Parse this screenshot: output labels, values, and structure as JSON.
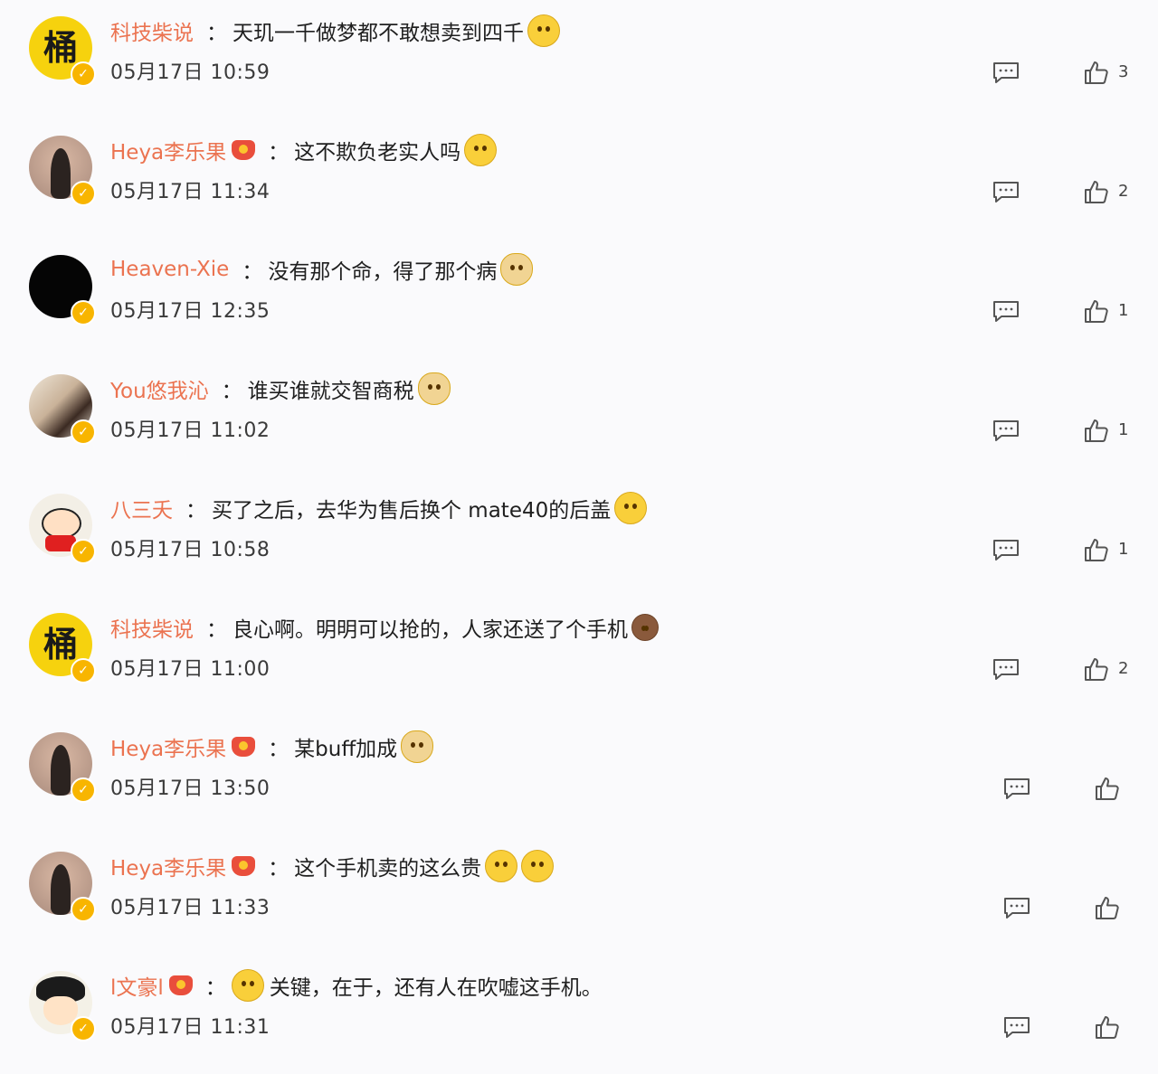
{
  "comments": [
    {
      "user": "科技柴说",
      "avatar": "bucket",
      "avatar_text": "桶",
      "medal": false,
      "sep": "：",
      "text": "天玑一千做梦都不敢想卖到四千",
      "emojis": [
        "grin-emoji"
      ],
      "time": "05月17日 10:59",
      "likes": "3",
      "layout": "wide"
    },
    {
      "user": "Heya李乐果",
      "avatar": "silhouette",
      "medal": true,
      "sep": "：",
      "text": "这不欺负老实人吗",
      "emojis": [
        "cry-laugh-emoji"
      ],
      "time": "05月17日 11:34",
      "likes": "2",
      "layout": "wide"
    },
    {
      "user": "Heaven-Xie",
      "avatar": "black",
      "medal": false,
      "sep": "：",
      "text": "没有那个命，得了那个病",
      "emojis": [
        "doge-emoji"
      ],
      "time": "05月17日 12:35",
      "likes": "1",
      "layout": "wide"
    },
    {
      "user": "You悠我沁",
      "avatar": "photo",
      "medal": false,
      "sep": "：",
      "text": "谁买谁就交智商税",
      "emojis": [
        "doge-emoji"
      ],
      "time": "05月17日 11:02",
      "likes": "1",
      "layout": "wide"
    },
    {
      "user": "八三夭",
      "avatar": "cartoon",
      "medal": false,
      "sep": "：",
      "text": "买了之后，去华为售后换个 mate40的后盖",
      "emojis": [
        "dizzy-emoji"
      ],
      "time": "05月17日 10:58",
      "likes": "1",
      "layout": "wide"
    },
    {
      "user": "科技柴说",
      "avatar": "bucket",
      "avatar_text": "桶",
      "medal": false,
      "sep": "：",
      "text": "良心啊。明明可以抢的，人家还送了个手机",
      "emojis": [
        "monkey-emoji"
      ],
      "time": "05月17日 11:00",
      "likes": "2",
      "layout": "wide"
    },
    {
      "user": "Heya李乐果",
      "avatar": "silhouette",
      "medal": true,
      "sep": "：",
      "text": "某buff加成",
      "emojis": [
        "doge-emoji"
      ],
      "time": "05月17日 13:50",
      "likes": "",
      "layout": "narrow"
    },
    {
      "user": "Heya李乐果",
      "avatar": "silhouette",
      "medal": true,
      "sep": "：",
      "text": "这个手机卖的这么贵",
      "emojis": [
        "laugh-cry-emoji",
        "laugh-cry-emoji"
      ],
      "time": "05月17日 11:33",
      "likes": "",
      "layout": "narrow"
    },
    {
      "user": "l文豪l",
      "avatar": "luffy",
      "medal": true,
      "sep": "：",
      "lead_emoji": "melon-emoji",
      "text": "关键，在于，还有人在吹嘘这手机。",
      "emojis": [],
      "time": "05月17日 11:31",
      "likes": "",
      "layout": "narrow"
    }
  ]
}
